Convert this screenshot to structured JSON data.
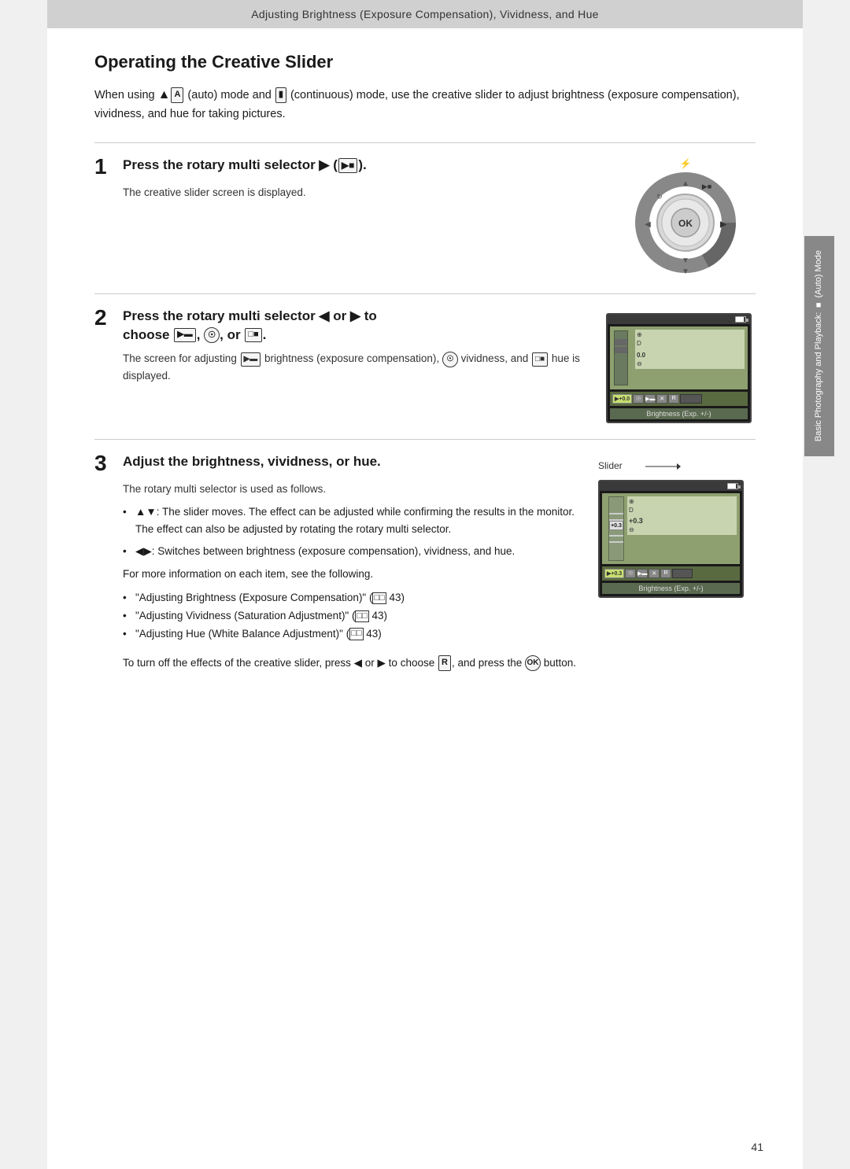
{
  "header": {
    "title": "Adjusting Brightness (Exposure Compensation), Vividness, and Hue"
  },
  "page_number": "41",
  "right_tab": {
    "line1": "Basic Photography and Playback:",
    "line2": "⬛ (Auto) Mode"
  },
  "section": {
    "title": "Operating the Creative Slider",
    "intro": "When using 🅐 (auto) mode and 🅑 (continuous) mode, use the creative slider to adjust brightness (exposure compensation), vividness, and hue for taking pictures.",
    "intro_plain": "When using  (auto) mode and  (continuous) mode, use the creative slider to adjust brightness (exposure compensation), vividness, and hue for taking pictures."
  },
  "step1": {
    "number": "1",
    "title": "Press the rotary multi selector ▶ (🎞).",
    "title_plain": "Press the rotary multi selector ▶ (  ).",
    "desc": "The creative slider screen is displayed."
  },
  "step2": {
    "number": "2",
    "title": "Press the rotary multi selector ◀ or ▶ to choose 🎞, 🎨, or 🎭.",
    "title_plain": "Press the rotary multi selector ◀ or ▶ to choose  ,  , or  .",
    "desc_plain": "The screen for adjusting  brightness (exposure compensation),  vividness, and  hue is displayed."
  },
  "step3": {
    "number": "3",
    "title": "Adjust the brightness, vividness, or hue.",
    "desc1": "The rotary multi selector is used as follows.",
    "bullets": [
      "▲▼: The slider moves. The effect can be adjusted while confirming the results in the monitor. The effect can also be adjusted by rotating the rotary multi selector.",
      "◀▶: Switches between brightness (exposure compensation), vividness, and hue."
    ],
    "for_more": "For more information on each item, see the following.",
    "refs": [
      "\"Adjusting Brightness (Exposure Compensation)\" (📖 43)",
      "\"Adjusting Vividness (Saturation Adjustment)\" (📖 43)",
      "\"Adjusting Hue (White Balance Adjustment)\" (📖 43)"
    ],
    "refs_plain": [
      "\"Adjusting Brightness (Exposure Compensation)\" (  43)",
      "\"Adjusting Vividness (Saturation Adjustment)\" (  43)",
      "\"Adjusting Hue (White Balance Adjustment)\" (  43)"
    ],
    "footer": "To turn off the effects of the creative slider, press ◀ or ▶ to choose  , and press the  button.",
    "slider_label": "Slider",
    "lcd_label": "Brightness (Exp. +/-)"
  }
}
